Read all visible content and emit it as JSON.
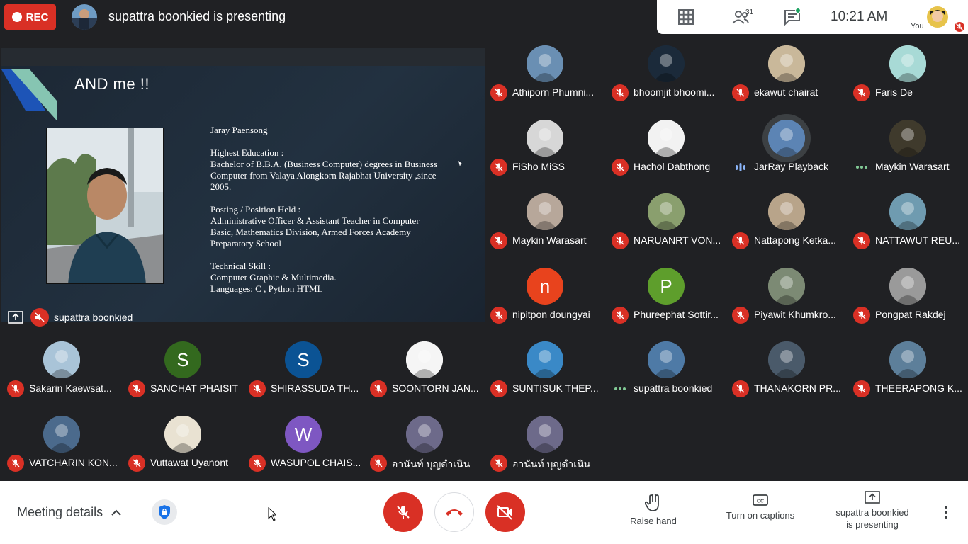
{
  "top": {
    "rec_label": "REC",
    "presenting_title": "supattra boonkied is presenting",
    "people_count": "31",
    "time": "10:21 AM",
    "you_label": "You"
  },
  "presentation": {
    "slide_title": "AND me !!",
    "slide_body": "Jaray Paensong\n\nHighest Education :\nBachelor of B.B.A. (Business Computer) degrees in Business Computer from Valaya Alongkorn Rajabhat University ,since 2005.\n\nPosting / Position Held :\nAdministrative Officer & Assistant Teacher in Computer Basic, Mathematics Division, Armed Forces Academy Preparatory School\n\nTechnical Skill :\nComputer Graphic & Multimedia.\nLanguages: C , Python HTML",
    "presenter_name": "supattra boonkied"
  },
  "participants": [
    {
      "name": "Athiporn Phumni...",
      "status": "muted",
      "avatar": "photo",
      "color": "#6a8fb3"
    },
    {
      "name": "bhoomjit bhoomi...",
      "status": "muted",
      "avatar": "photo",
      "color": "#1b2a3a"
    },
    {
      "name": "ekawut chairat",
      "status": "muted",
      "avatar": "photo",
      "color": "#c9b89a"
    },
    {
      "name": "Faris De",
      "status": "muted",
      "avatar": "photo",
      "color": "#a8dad6"
    },
    {
      "name": "FiSho MiSS",
      "status": "muted",
      "avatar": "photo",
      "color": "#d7d7d7"
    },
    {
      "name": "Hachol Dabthong",
      "status": "muted",
      "avatar": "photo",
      "color": "#f2f2f2"
    },
    {
      "name": "JarRay Playback",
      "status": "speaking",
      "avatar": "photo",
      "color": "#5c84b4"
    },
    {
      "name": "Maykin Warasart",
      "status": "idle",
      "avatar": "photo",
      "color": "#3f3a2c"
    },
    {
      "name": "Maykin Warasart",
      "status": "muted",
      "avatar": "photo",
      "color": "#b7a79a"
    },
    {
      "name": "NARUANRT VON...",
      "status": "muted",
      "avatar": "photo",
      "color": "#8a9f6e"
    },
    {
      "name": "Nattapong Ketka...",
      "status": "muted",
      "avatar": "photo",
      "color": "#b8a48a"
    },
    {
      "name": "NATTAWUT REU...",
      "status": "muted",
      "avatar": "photo",
      "color": "#6f9bb0"
    },
    {
      "name": "nipitpon doungyai",
      "status": "muted",
      "avatar": "letter",
      "letter": "n",
      "color": "#e8431d"
    },
    {
      "name": "Phureephat Sottir...",
      "status": "muted",
      "avatar": "letter",
      "letter": "P",
      "color": "#5e9e2c"
    },
    {
      "name": "Piyawit Khumkro...",
      "status": "muted",
      "avatar": "photo",
      "color": "#7c8a74"
    },
    {
      "name": "Pongpat Rakdej",
      "status": "muted",
      "avatar": "photo",
      "color": "#9a9a9a"
    },
    {
      "name": "SUNTISUK THEP...",
      "status": "muted",
      "avatar": "photo",
      "color": "#3a89c7"
    },
    {
      "name": "supattra boonkied",
      "status": "idle",
      "avatar": "photo",
      "color": "#4e7aa6"
    },
    {
      "name": "THANAKORN PR...",
      "status": "muted",
      "avatar": "photo",
      "color": "#4a5a6a"
    },
    {
      "name": "THEERAPONG K...",
      "status": "muted",
      "avatar": "photo",
      "color": "#5d7f9a"
    },
    {
      "name": "Sakarin Kaewsat...",
      "status": "muted",
      "avatar": "photo",
      "color": "#a9c4d8"
    },
    {
      "name": "SANCHAT PHAISIT",
      "status": "muted",
      "avatar": "letter",
      "letter": "S",
      "color": "#33691e"
    },
    {
      "name": "SHIRASSUDA TH...",
      "status": "muted",
      "avatar": "letter",
      "letter": "S",
      "color": "#0b5394"
    },
    {
      "name": "SOONTORN JAN...",
      "status": "muted",
      "avatar": "photo",
      "color": "#f5f5f5"
    },
    {
      "name": "VATCHARIN KON...",
      "status": "muted",
      "avatar": "photo",
      "color": "#4b6a8c"
    },
    {
      "name": "Vuttawat Uyanont",
      "status": "muted",
      "avatar": "photo",
      "color": "#e9e2d2"
    },
    {
      "name": "WASUPOL CHAIS...",
      "status": "muted",
      "avatar": "letter",
      "letter": "W",
      "color": "#7e57c2"
    },
    {
      "name": "อานันท์ บุญดำเนิน",
      "status": "muted",
      "avatar": "photo",
      "color": "#6d6a8a"
    },
    {
      "name": "อานันท์ บุญดำเนิน",
      "status": "muted",
      "avatar": "photo",
      "color": "#6d6a8a"
    }
  ],
  "bottom": {
    "meeting_details": "Meeting details",
    "raise_hand": "Raise hand",
    "captions": "Turn on captions",
    "presenting_line1": "supattra boonkied",
    "presenting_line2": "is presenting"
  },
  "colors": {
    "danger": "#d93025",
    "background": "#202124",
    "speaking": "#8ab4f8",
    "idle": "#81c995"
  }
}
